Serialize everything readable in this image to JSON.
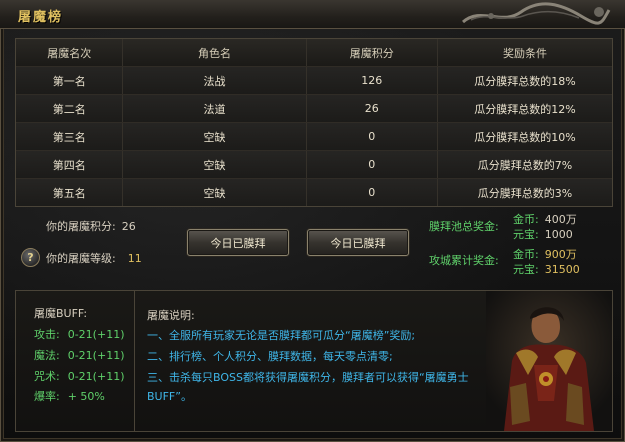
{
  "window": {
    "title": "屠魔榜"
  },
  "table": {
    "headers": [
      "屠魔名次",
      "角色名",
      "屠魔积分",
      "奖励条件"
    ],
    "rows": [
      [
        "第一名",
        "法战",
        "126",
        "瓜分膜拜总数的18%"
      ],
      [
        "第二名",
        "法道",
        "26",
        "瓜分膜拜总数的12%"
      ],
      [
        "第三名",
        "空缺",
        "0",
        "瓜分膜拜总数的10%"
      ],
      [
        "第四名",
        "空缺",
        "0",
        "瓜分膜拜总数的7%"
      ],
      [
        "第五名",
        "空缺",
        "0",
        "瓜分膜拜总数的3%"
      ]
    ]
  },
  "player": {
    "points_label": "你的屠魔积分:",
    "points": "26",
    "level_label": "你的屠魔等级:",
    "level": "11",
    "help_icon_glyph": "?"
  },
  "buttons": {
    "worship1": "今日已膜拜",
    "worship2": "今日已膜拜"
  },
  "pool": {
    "label": "膜拜池总奖金:",
    "gold_label": "金币:",
    "gold": "400万",
    "gem_label": "元宝:",
    "gem": "1000"
  },
  "city": {
    "label": "攻城累计奖金:",
    "gold_label": "金币:",
    "gold": "900万",
    "gem_label": "元宝:",
    "gem": "31500"
  },
  "buff": {
    "title": "屠魔BUFF:",
    "lines": [
      {
        "label": "攻击:",
        "value": "0-21(+11)"
      },
      {
        "label": "魔法:",
        "value": "0-21(+11)"
      },
      {
        "label": "咒术:",
        "value": "0-21(+11)"
      },
      {
        "label": "爆率:",
        "value": "+ 50%"
      }
    ]
  },
  "description": {
    "title": "屠魔说明:",
    "lines": [
      "一、全服所有玩家无论是否膜拜都可瓜分“屠魔榜”奖励;",
      "二、排行榜、个人积分、膜拜数据，每天零点清零;",
      "三、击杀每只BOSS都将获得屠魔积分，膜拜者可以获得“屠魔勇士BUFF”。"
    ]
  },
  "colors": {
    "accent_gold": "#e0c060",
    "green": "#5fd06a",
    "blue": "#3fb6e8"
  },
  "icons": [
    "dragon-ornament-icon",
    "help-icon",
    "hero-portrait"
  ]
}
